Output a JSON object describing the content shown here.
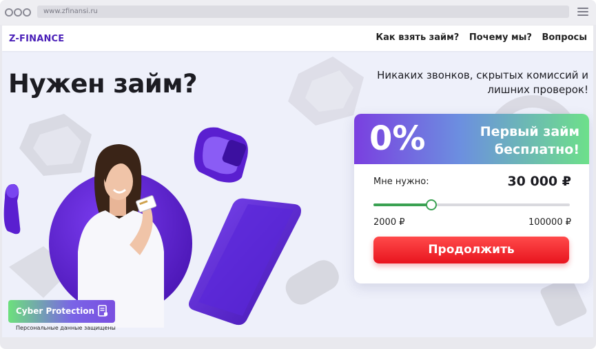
{
  "browser": {
    "url": "www.zfinansi.ru"
  },
  "nav": {
    "logo": "Z-FINANCE",
    "links": [
      "Как взять займ?",
      "Почему мы?",
      "Вопросы"
    ]
  },
  "hero": {
    "title": "Нужен займ?",
    "tagline_line1": "Никаких звонков, скрытых комиссий и",
    "tagline_line2": "лишних проверок!"
  },
  "card": {
    "percent": "0%",
    "offer_line1": "Первый займ",
    "offer_line2": "бесплатно!",
    "need_label": "Мне нужно:",
    "need_value": "30 000 ₽",
    "slider_min": "2000 ₽",
    "slider_max": "100000 ₽",
    "slider_value_fraction": 0.29,
    "button": "Продолжить"
  },
  "badge": {
    "label": "Cyber Protection",
    "sub": "Персональные данные защищены"
  },
  "colors": {
    "brand": "#4a20b8",
    "accent_red": "#e8141e",
    "slider_green": "#3aa152",
    "purple": "#6a2fd6"
  }
}
